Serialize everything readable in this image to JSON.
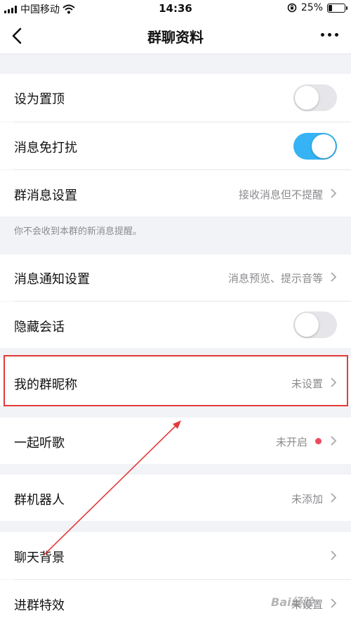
{
  "status_bar": {
    "carrier": "中国移动",
    "time": "14:36",
    "battery_percent": "25%",
    "battery_level": 0.25
  },
  "nav": {
    "title": "群聊资料"
  },
  "settings": {
    "pin_top": {
      "label": "设为置顶",
      "enabled": false
    },
    "mute": {
      "label": "消息免打扰",
      "enabled": true
    },
    "group_msg_settings": {
      "label": "群消息设置",
      "value": "接收消息但不提醒"
    },
    "mute_note": "你不会收到本群的新消息提醒。",
    "notify_settings": {
      "label": "消息通知设置",
      "value": "消息预览、提示音等"
    },
    "hide_chat": {
      "label": "隐藏会话",
      "enabled": false
    },
    "my_nickname": {
      "label": "我的群昵称",
      "value": "未设置"
    },
    "listen_together": {
      "label": "一起听歌",
      "value": "未开启"
    },
    "group_robot": {
      "label": "群机器人",
      "value": "未添加"
    },
    "chat_background": {
      "label": "聊天背景"
    },
    "join_effect": {
      "label": "进群特效",
      "value": "未设置"
    }
  },
  "watermark": "Bai经验",
  "colors": {
    "toggle_on": "#35b3f4",
    "highlight": "#e23a3a",
    "annotation_arrow": "#e23a3a",
    "notification_dot": "#ee4a5e"
  }
}
